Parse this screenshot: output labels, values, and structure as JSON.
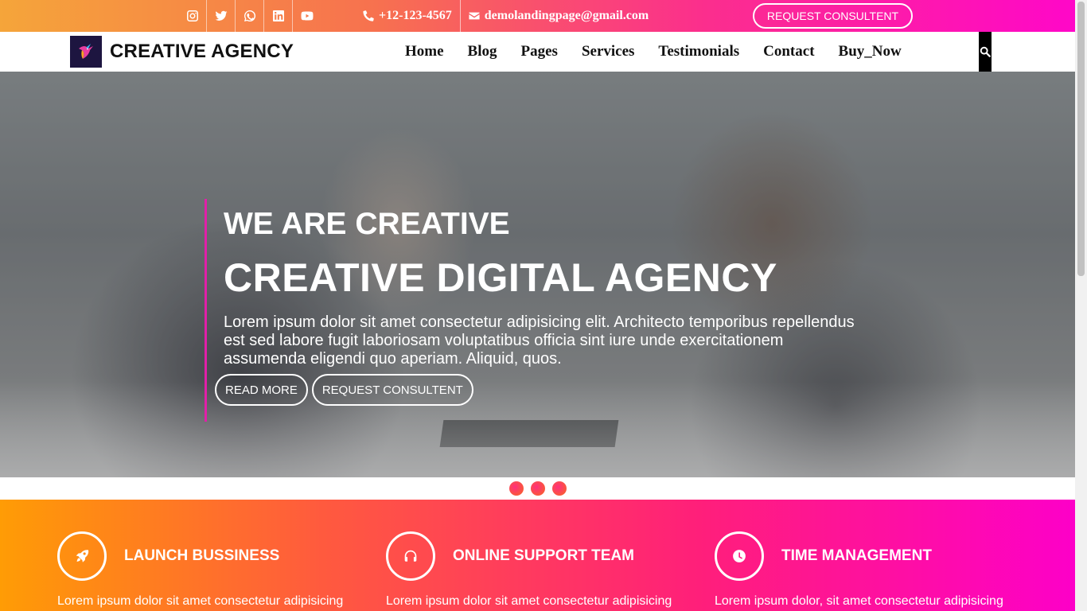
{
  "topbar": {
    "social": [
      {
        "icon": "instagram-icon"
      },
      {
        "icon": "twitter-icon"
      },
      {
        "icon": "whatsapp-icon"
      },
      {
        "icon": "linkedin-icon"
      },
      {
        "icon": "youtube-icon"
      }
    ],
    "phone": "+12-123-4567",
    "email": "demolandingpage@gmail.com",
    "request_button": "REQUEST CONSULTENT"
  },
  "navbar": {
    "brand": "CREATIVE AGENCY",
    "links": [
      "Home",
      "Blog",
      "Pages",
      "Services",
      "Testimonials",
      "Contact",
      "Buy_Now"
    ]
  },
  "hero": {
    "subtitle": "WE ARE CREATIVE",
    "title": "CREATIVE DIGITAL AGENCY",
    "text": "Lorem ipsum dolor sit amet consectetur adipisicing elit. Architecto temporibus repellendus est sed labore fugit laboriosam voluptatibus officia sint iure unde exercitationem assumenda eligendi quo aperiam. Aliquid, quos.",
    "read_more": "READ MORE",
    "request": "REQUEST CONSULTENT"
  },
  "features": [
    {
      "icon": "rocket-icon",
      "title": "LAUNCH BUSSINESS",
      "text": "Lorem ipsum dolor sit amet consectetur adipisicing elit."
    },
    {
      "icon": "headphones-icon",
      "title": "ONLINE SUPPORT TEAM",
      "text": "Lorem ipsum dolor sit amet consectetur adipisicing elit."
    },
    {
      "icon": "clock-icon",
      "title": "TIME MANAGEMENT",
      "text": "Lorem ipsum dolor, sit amet consectetur adipisicing elit."
    }
  ],
  "colors": {
    "topbar_gradient": [
      "#f5a53a",
      "#fb2f8c",
      "#ff07c8"
    ],
    "features_gradient": [
      "#ff9c05",
      "#ff1f7a",
      "#fd00c8"
    ],
    "accent": "#e21fa9"
  }
}
